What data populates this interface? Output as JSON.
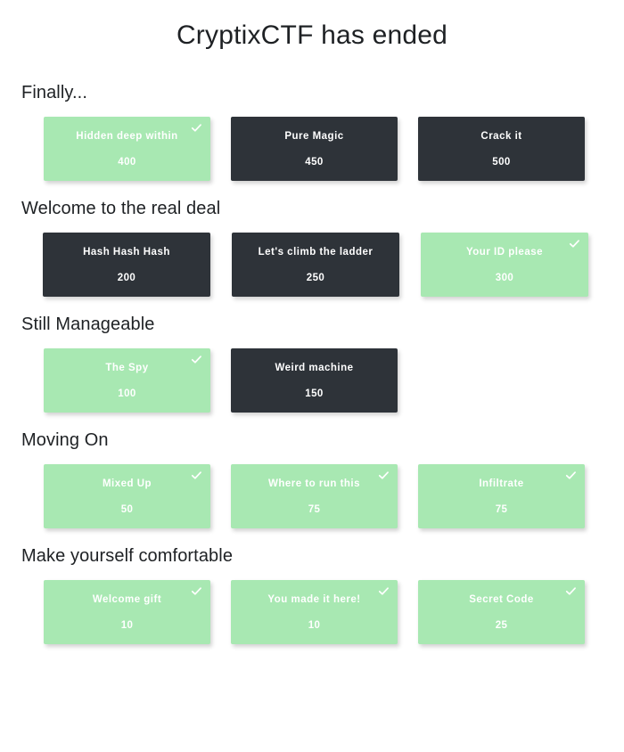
{
  "header": {
    "title": "CryptixCTF has ended"
  },
  "icons": {
    "solved": "check-icon"
  },
  "colors": {
    "solved_card": "#a8e8b2",
    "unsolved_card": "#2e3339",
    "card_text": "#ffffff",
    "heading_text": "#1e2124",
    "page_background": "#ffffff"
  },
  "categories": [
    {
      "name": "Finally...",
      "challenges": [
        {
          "name": "Hidden deep within",
          "points": "400",
          "solved": true
        },
        {
          "name": "Pure Magic",
          "points": "450",
          "solved": false
        },
        {
          "name": "Crack it",
          "points": "500",
          "solved": false
        }
      ]
    },
    {
      "name": "Welcome to the real deal",
      "challenges": [
        {
          "name": "Hash Hash Hash",
          "points": "200",
          "solved": false
        },
        {
          "name": "Let's climb the ladder",
          "points": "250",
          "solved": false
        },
        {
          "name": "Your ID please",
          "points": "300",
          "solved": true
        }
      ]
    },
    {
      "name": "Still Manageable",
      "challenges": [
        {
          "name": "The Spy",
          "points": "100",
          "solved": true
        },
        {
          "name": "Weird machine",
          "points": "150",
          "solved": false
        }
      ]
    },
    {
      "name": "Moving On",
      "challenges": [
        {
          "name": "Mixed Up",
          "points": "50",
          "solved": true
        },
        {
          "name": "Where to run this",
          "points": "75",
          "solved": true
        },
        {
          "name": "Infiltrate",
          "points": "75",
          "solved": true
        }
      ]
    },
    {
      "name": "Make yourself comfortable",
      "challenges": [
        {
          "name": "Welcome gift",
          "points": "10",
          "solved": true
        },
        {
          "name": "You made it here!",
          "points": "10",
          "solved": true
        },
        {
          "name": "Secret Code",
          "points": "25",
          "solved": true
        }
      ]
    }
  ]
}
